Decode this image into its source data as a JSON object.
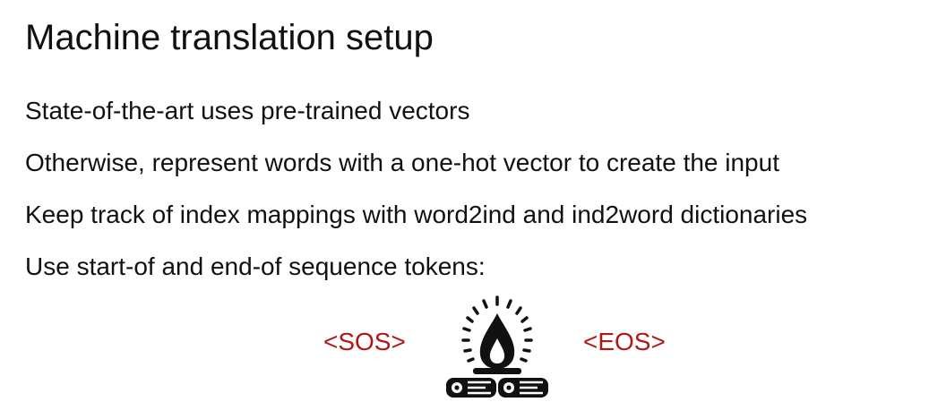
{
  "slide": {
    "title": "Machine translation setup",
    "bullets": [
      "State-of-the-art uses pre-trained vectors",
      "Otherwise, represent words with a one-hot vector to create the input",
      "Keep track of index mappings with word2ind and ind2word dictionaries",
      "Use start-of and end-of sequence tokens:"
    ]
  },
  "tokens": {
    "start": "<SOS>",
    "end": "<EOS>",
    "color": "#b01818"
  },
  "icon": {
    "name": "campfire-icon",
    "color": "#111111"
  }
}
